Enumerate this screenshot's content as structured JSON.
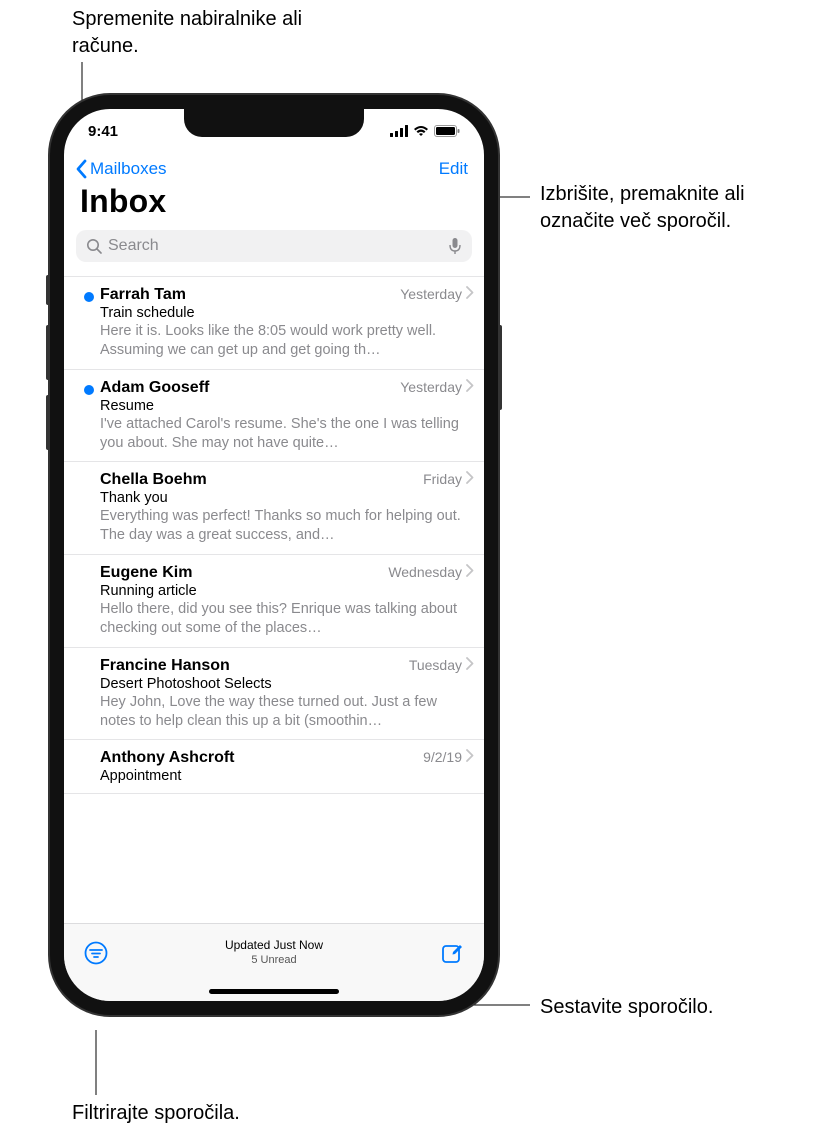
{
  "annotations": {
    "top_left": "Spremenite nabiralnike ali račune.",
    "top_right": "Izbrišite, premaknite ali označite več sporočil.",
    "bottom_right": "Sestavite sporočilo.",
    "bottom_left": "Filtrirajte sporočila."
  },
  "status": {
    "time": "9:41"
  },
  "nav": {
    "back_label": "Mailboxes",
    "edit_label": "Edit"
  },
  "title": "Inbox",
  "search": {
    "placeholder": "Search"
  },
  "messages": [
    {
      "unread": true,
      "sender": "Farrah Tam",
      "date": "Yesterday",
      "subject": "Train schedule",
      "preview": "Here it is. Looks like the 8:05 would work pretty well. Assuming we can get up and get going th…"
    },
    {
      "unread": true,
      "sender": "Adam Gooseff",
      "date": "Yesterday",
      "subject": "Resume",
      "preview": "I've attached Carol's resume. She's the one I was telling you about. She may not have quite…"
    },
    {
      "unread": false,
      "sender": "Chella Boehm",
      "date": "Friday",
      "subject": "Thank you",
      "preview": "Everything was perfect! Thanks so much for helping out. The day was a great success, and…"
    },
    {
      "unread": false,
      "sender": "Eugene Kim",
      "date": "Wednesday",
      "subject": "Running article",
      "preview": "Hello there, did you see this? Enrique was talking about checking out some of the places…"
    },
    {
      "unread": false,
      "sender": "Francine Hanson",
      "date": "Tuesday",
      "subject": "Desert Photoshoot Selects",
      "preview": "Hey John, Love the way these turned out. Just a few notes to help clean this up a bit (smoothin…"
    },
    {
      "unread": false,
      "sender": "Anthony Ashcroft",
      "date": "9/2/19",
      "subject": "Appointment",
      "preview": ""
    }
  ],
  "toolbar": {
    "updated": "Updated Just Now",
    "unread": "5 Unread"
  }
}
